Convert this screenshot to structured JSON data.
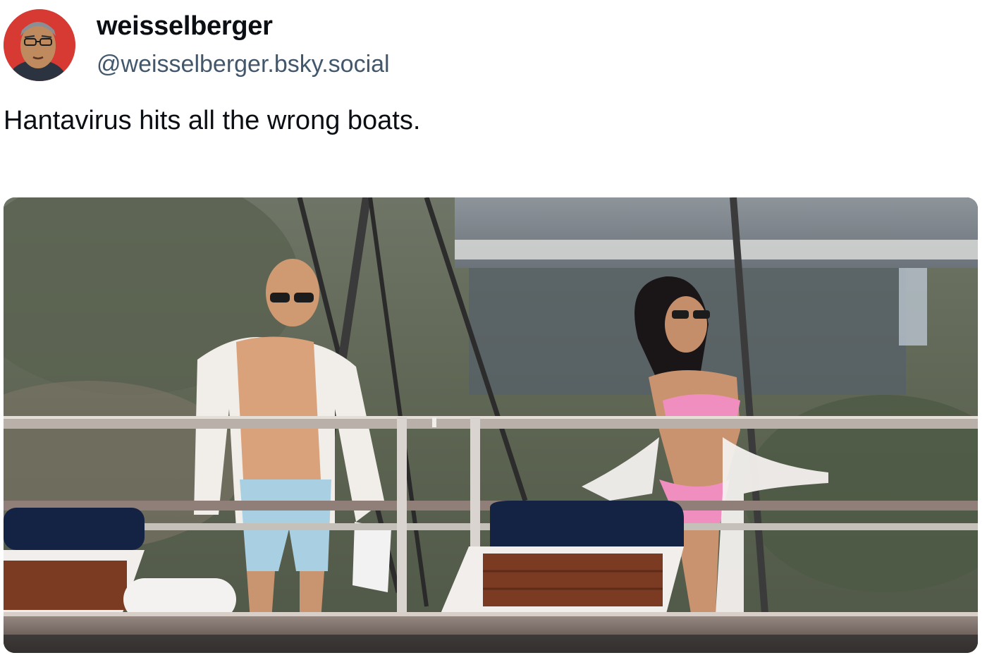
{
  "post": {
    "author": {
      "display_name": "weisselberger",
      "handle": "@weisselberger.bsky.social",
      "avatar_icon": "avatar-portrait-icon"
    },
    "text": "Hantavirus hits all the wrong boats.",
    "media": {
      "type": "photo",
      "description_icon": "yacht-deck-photo"
    }
  },
  "colors": {
    "text_primary": "#0b0f14",
    "text_secondary": "#42576c",
    "avatar_background": "#d63a33"
  }
}
